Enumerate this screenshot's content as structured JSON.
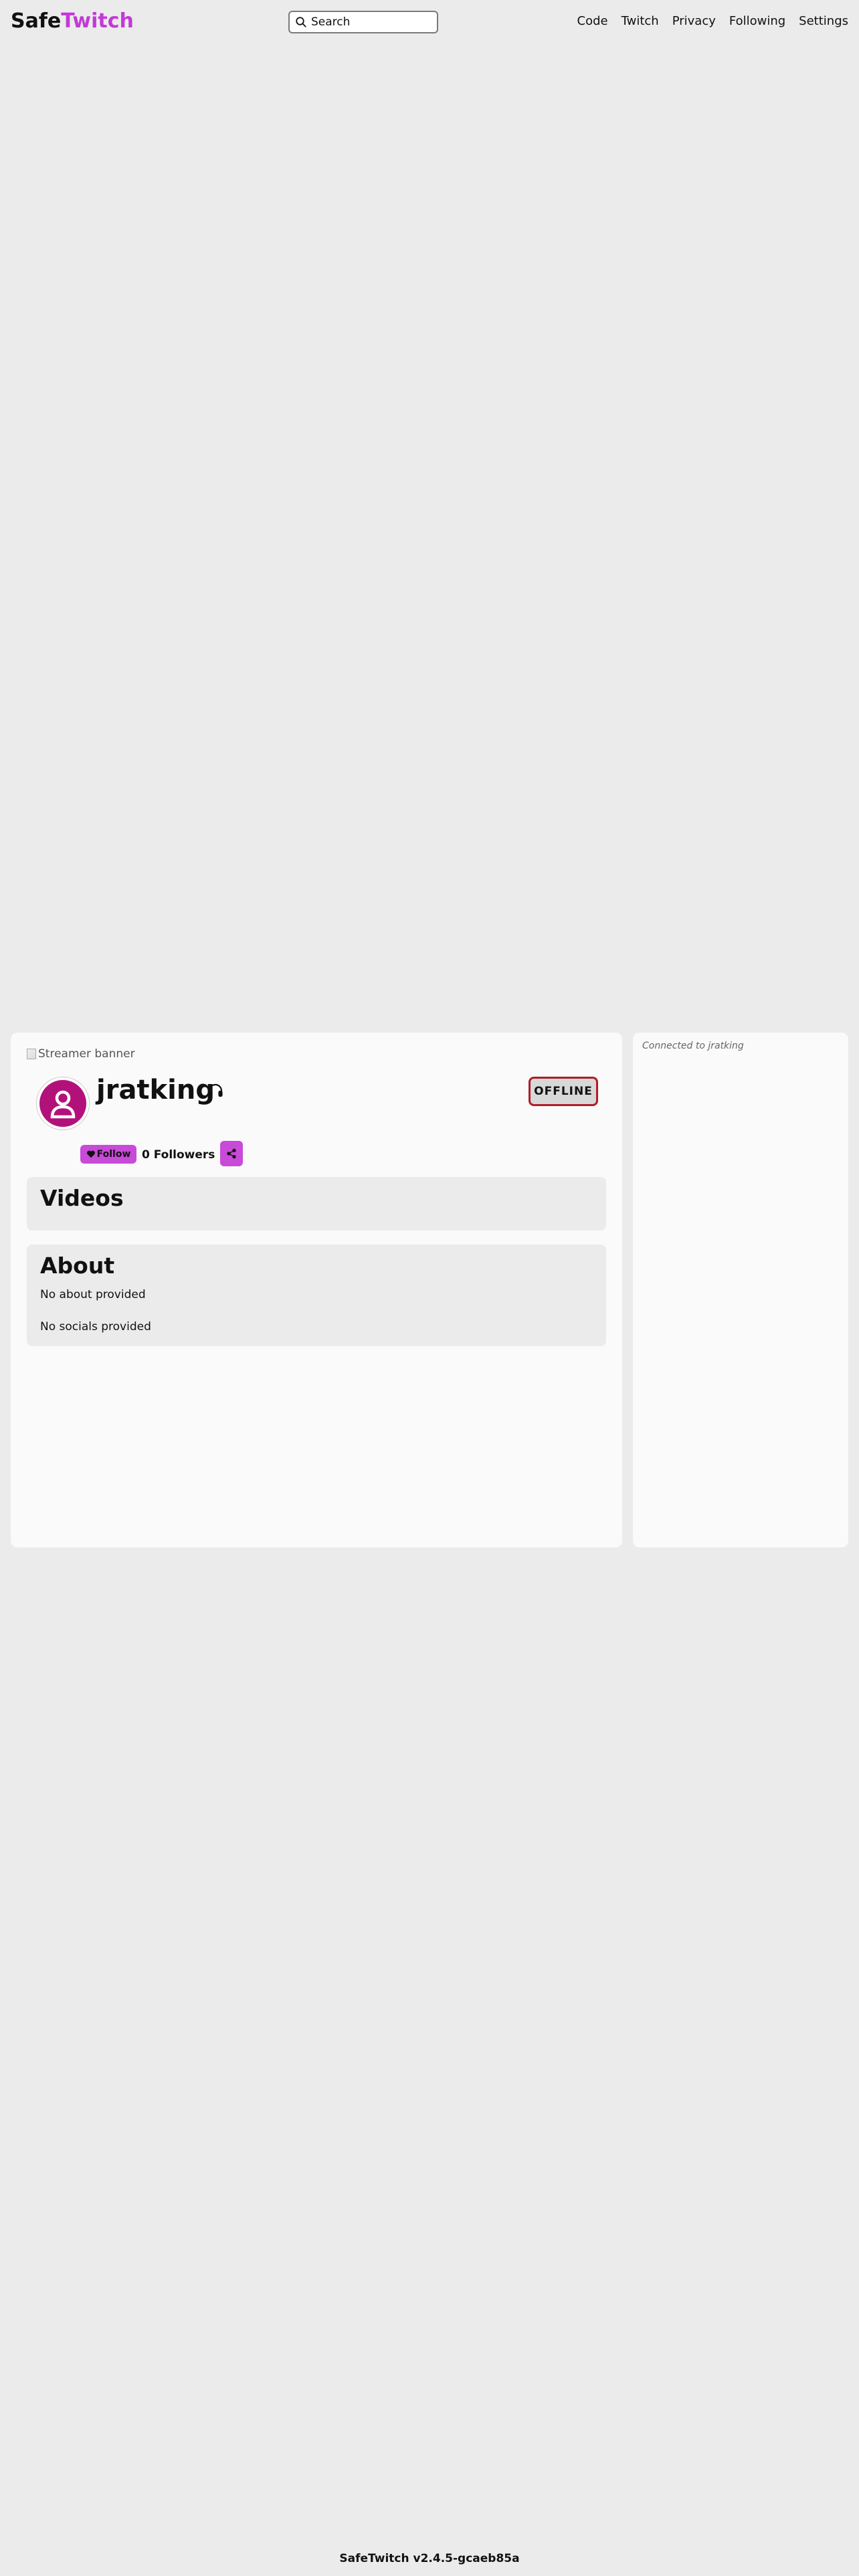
{
  "brand": {
    "part1": "Safe",
    "part2": "Twitch",
    "accent_color": "#c239d6"
  },
  "search": {
    "placeholder": "Search",
    "icon": "search-icon"
  },
  "nav": {
    "links": [
      "Code",
      "Twitch",
      "Privacy",
      "Following",
      "Settings"
    ]
  },
  "profile": {
    "banner_alt": "Streamer banner",
    "username": "jratking",
    "category_icon": "headphones-icon",
    "status": "OFFLINE",
    "status_border_color": "#b01c2a",
    "avatar_color": "#b3117a",
    "follow_label": "Follow",
    "followers_text": "0 Followers",
    "share_icon": "share-icon"
  },
  "sections": {
    "videos": {
      "title": "Videos"
    },
    "about": {
      "title": "About",
      "about_text": "No about provided",
      "socials_text": "No socials provided"
    }
  },
  "chat": {
    "status": "Connected to jratking"
  },
  "footer": {
    "version": "SafeTwitch v2.4.5-gcaeb85a"
  }
}
